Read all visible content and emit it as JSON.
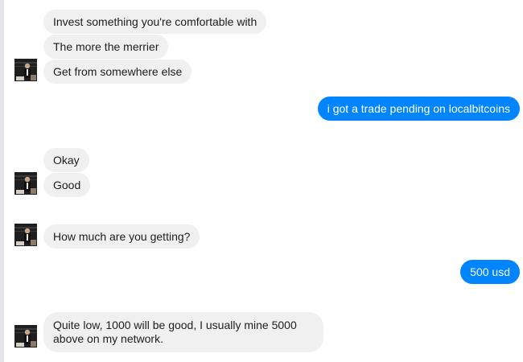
{
  "conversation": {
    "messages": [
      {
        "text": "Invest something you're comfortable with",
        "from": "them"
      },
      {
        "text": "The more the merrier",
        "from": "them"
      },
      {
        "text": "Get from somewhere else",
        "from": "them"
      },
      {
        "text": "i got a trade pending on localbitcoins",
        "from": "me"
      },
      {
        "text": "Okay",
        "from": "them"
      },
      {
        "text": "Good",
        "from": "them"
      },
      {
        "text": "How much are you getting?",
        "from": "them"
      },
      {
        "text": "500 usd",
        "from": "me"
      },
      {
        "text": "Quite low, 1000 will be good, I usually mine 5000 above on my network.",
        "from": "them"
      }
    ]
  },
  "colors": {
    "incoming_bubble": "#f0f0f0",
    "outgoing_bubble": "#0084ff",
    "outgoing_text": "#ffffff"
  },
  "icons": {
    "avatar": "contact-photo"
  }
}
